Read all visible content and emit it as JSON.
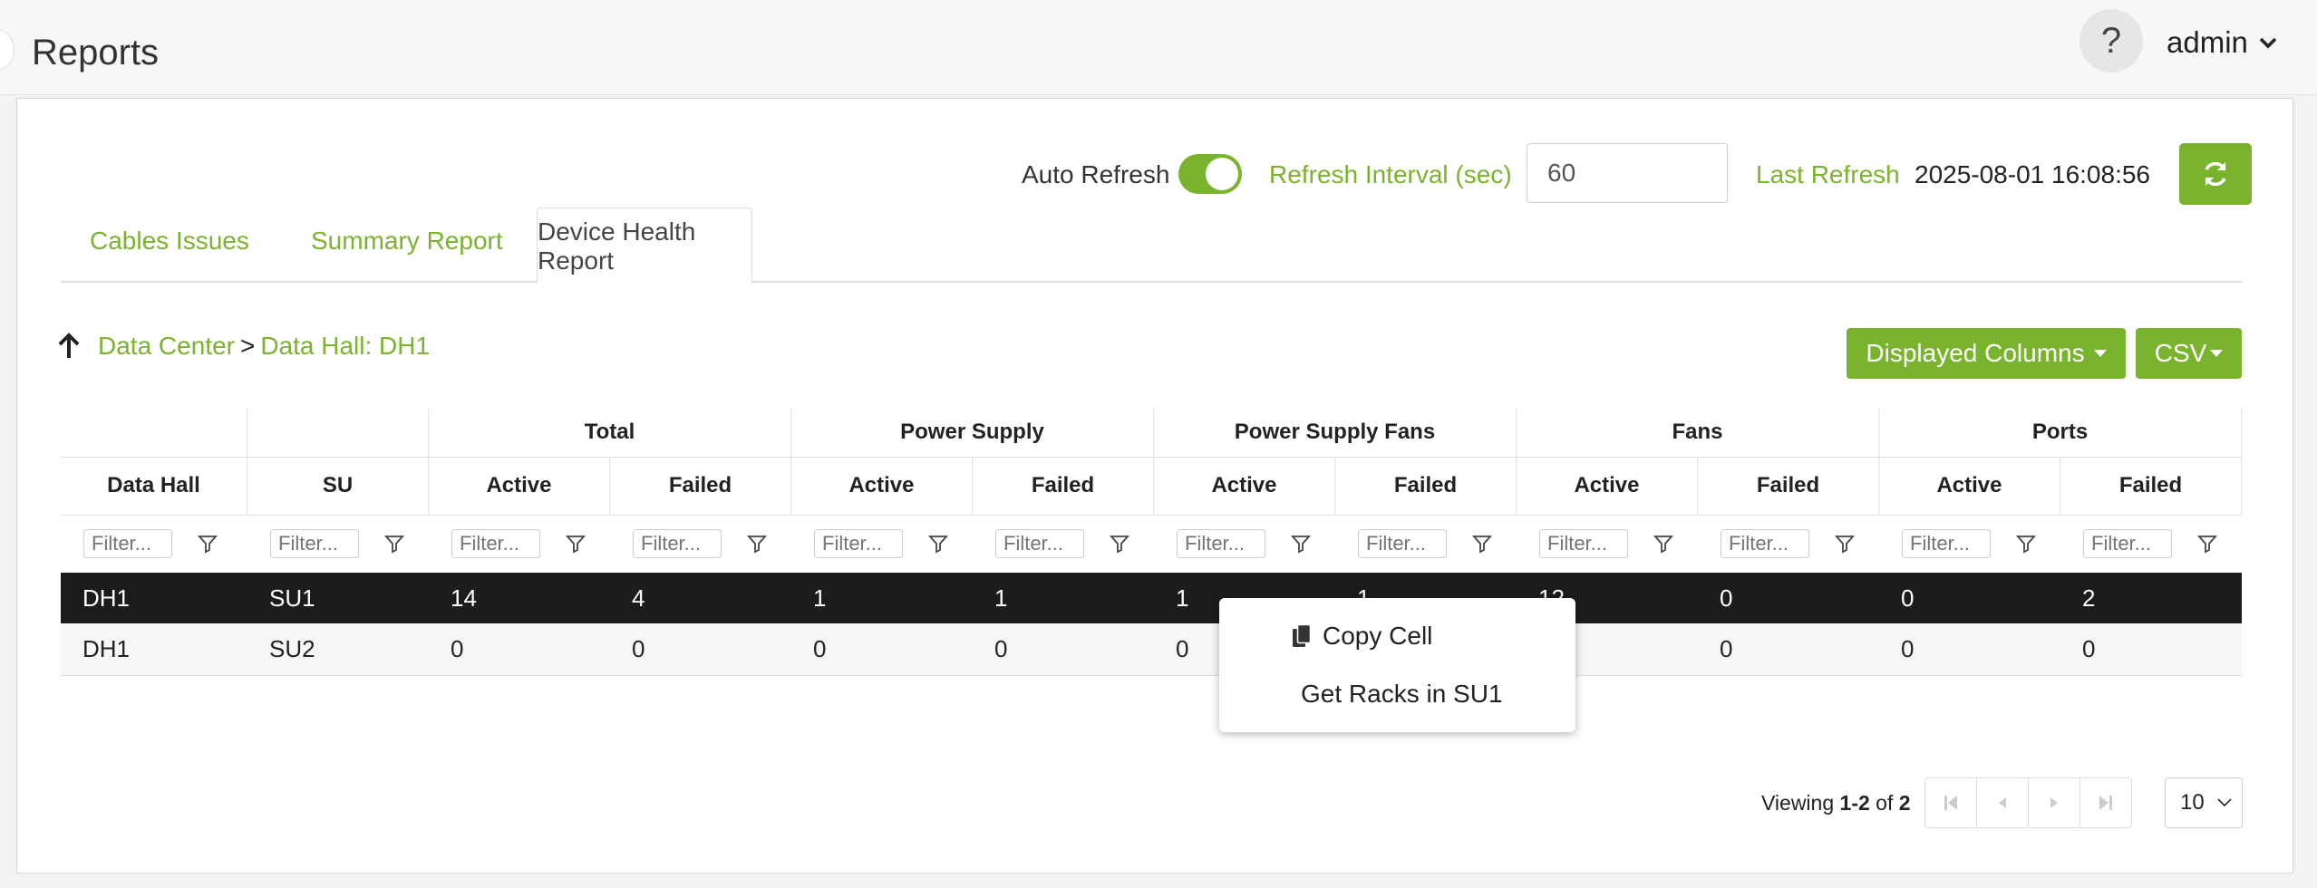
{
  "header": {
    "title": "Reports",
    "help": "?",
    "user": "admin"
  },
  "controls": {
    "auto_refresh_label": "Auto Refresh",
    "auto_refresh_on": true,
    "refresh_interval_label": "Refresh Interval (sec)",
    "refresh_interval_value": "60",
    "last_refresh_label": "Last Refresh",
    "last_refresh_value": "2025-08-01 16:08:56"
  },
  "tabs": [
    {
      "label": "Cables Issues",
      "active": false
    },
    {
      "label": "Summary Report",
      "active": false
    },
    {
      "label": "Device Health Report",
      "active": true
    }
  ],
  "breadcrumb": {
    "root": "Data Center",
    "separator": ">",
    "current": "Data Hall: DH1"
  },
  "toolbar": {
    "displayed_columns": "Displayed Columns",
    "csv": "CSV"
  },
  "table": {
    "groups": [
      "",
      "",
      "Total",
      "Power Supply",
      "Power Supply Fans",
      "Fans",
      "Ports"
    ],
    "columns": [
      "Data Hall",
      "SU",
      "Active",
      "Failed",
      "Active",
      "Failed",
      "Active",
      "Failed",
      "Active",
      "Failed",
      "Active",
      "Failed"
    ],
    "filter_placeholder": "Filter...",
    "rows": [
      [
        "DH1",
        "SU1",
        "14",
        "4",
        "1",
        "1",
        "1",
        "1",
        "12",
        "0",
        "0",
        "2"
      ],
      [
        "DH1",
        "SU2",
        "0",
        "0",
        "0",
        "0",
        "0",
        "",
        "",
        "0",
        "0",
        "0"
      ]
    ],
    "selected_row": 0
  },
  "context_menu": {
    "copy": "Copy Cell",
    "racks": "Get Racks in SU1"
  },
  "pagination": {
    "prefix": "Viewing",
    "range": "1-2",
    "of": "of",
    "total": "2",
    "page_size": "10"
  },
  "colors": {
    "accent": "#7ab32e",
    "selected_row": "#1c1c1c"
  }
}
